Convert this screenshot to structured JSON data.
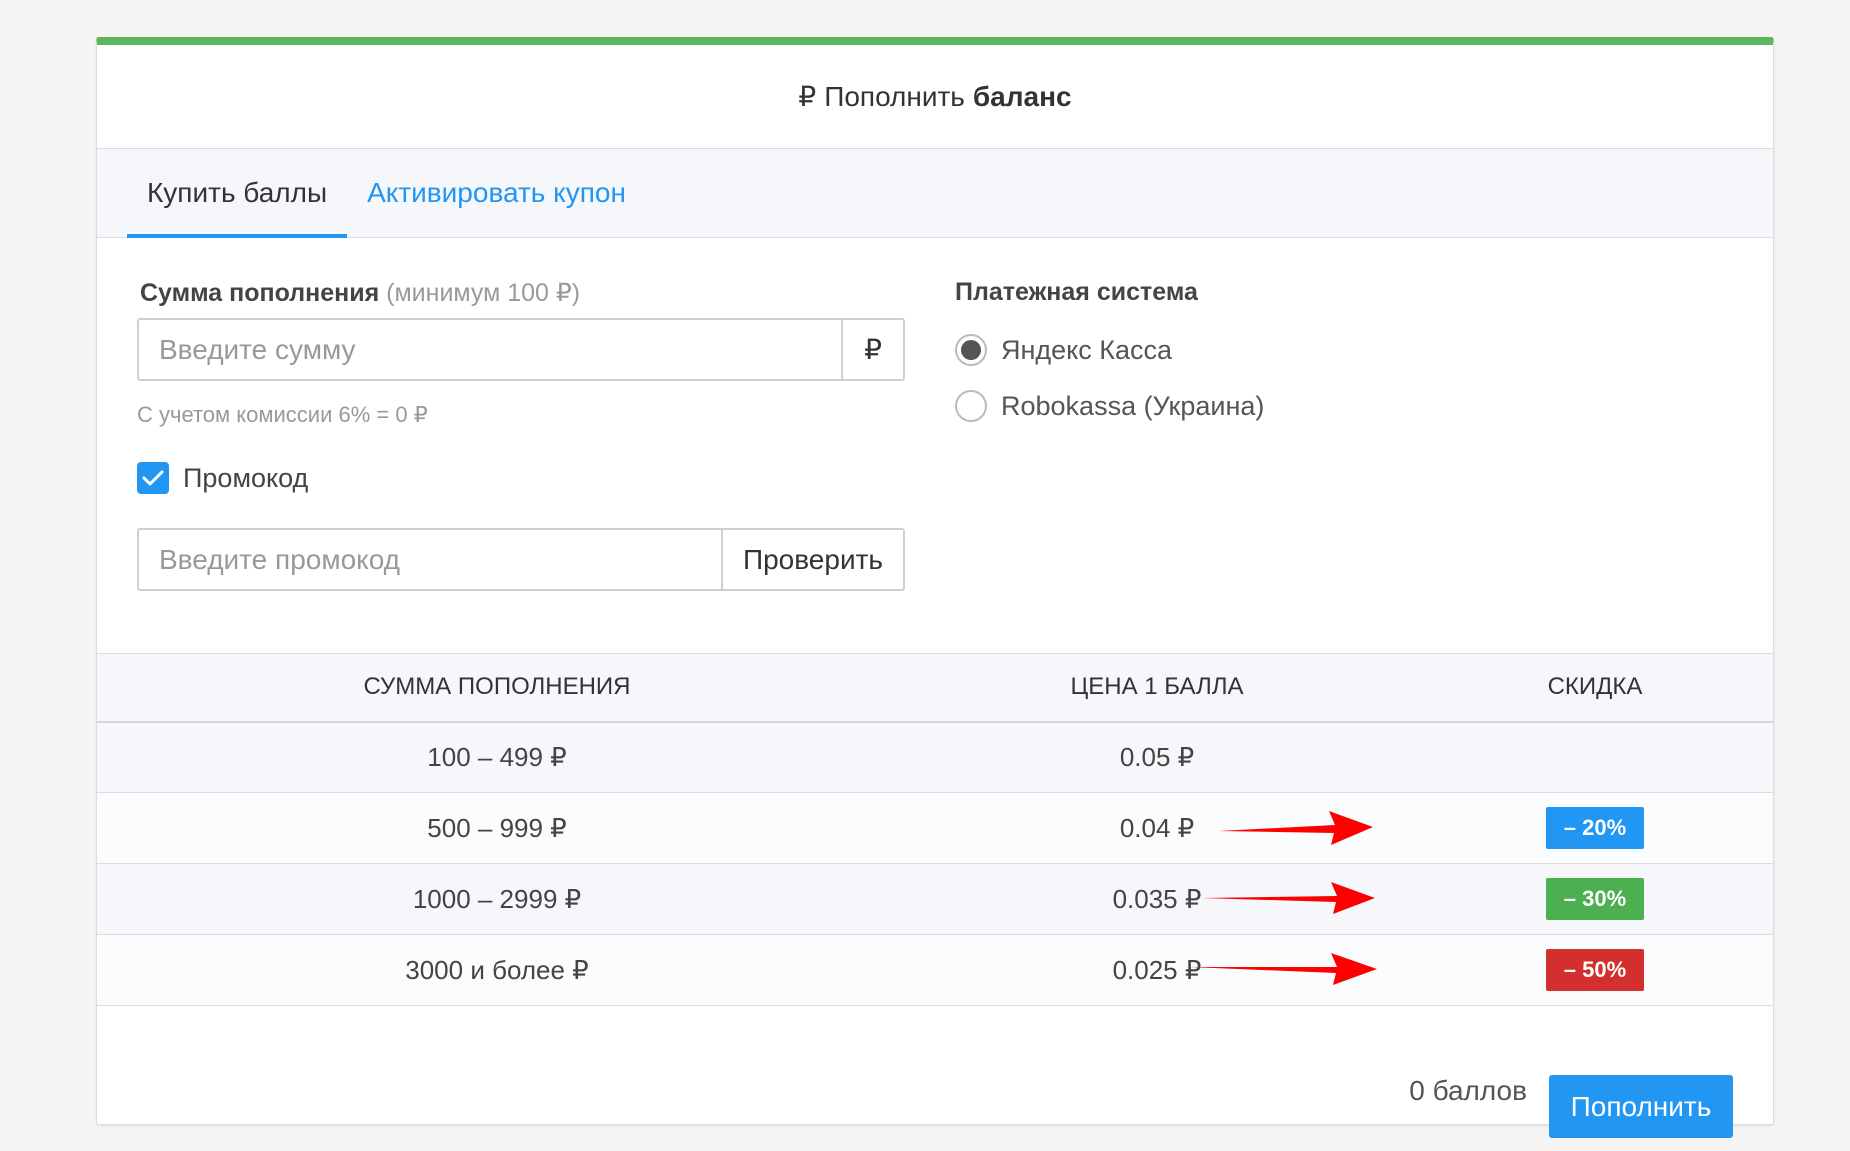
{
  "header": {
    "ruble_icon": "₽",
    "title_prefix": "Пополнить",
    "title_bold": "баланс"
  },
  "tabs": [
    {
      "label": "Купить баллы",
      "active": true
    },
    {
      "label": "Активировать купон",
      "active": false
    }
  ],
  "amount": {
    "label": "Сумма пополнения",
    "label_note": "(минимум 100 ₽)",
    "placeholder": "Введите сумму",
    "currency_addon": "₽",
    "commission_hint": "С учетом комиссии 6% = 0 ₽"
  },
  "promo": {
    "checkbox_label": "Промокод",
    "checked": true,
    "placeholder": "Введите промокод",
    "check_button": "Проверить"
  },
  "payment": {
    "label": "Платежная система",
    "options": [
      {
        "label": "Яндекс Касса",
        "checked": true
      },
      {
        "label": "Robokassa (Украина)",
        "checked": false
      }
    ]
  },
  "table": {
    "headers": [
      "СУММА ПОПОЛНЕНИЯ",
      "ЦЕНА 1 БАЛЛА",
      "СКИДКА"
    ],
    "rows": [
      {
        "range": "100 – 499 ₽",
        "price": "0.05 ₽",
        "discount": "",
        "color": ""
      },
      {
        "range": "500 – 999 ₽",
        "price": "0.04 ₽",
        "discount": "– 20%",
        "color": "#2196f3"
      },
      {
        "range": "1000 – 2999 ₽",
        "price": "0.035 ₽",
        "discount": "– 30%",
        "color": "#4caf50"
      },
      {
        "range": "3000 и более ₽",
        "price": "0.025 ₽",
        "discount": "– 50%",
        "color": "#d32f2f"
      }
    ]
  },
  "footer": {
    "points": "0 баллов",
    "submit": "Пополнить"
  },
  "colors": {
    "accent": "#2196f3",
    "top_bar": "#5cb85c",
    "arrow": "#ff0000"
  }
}
